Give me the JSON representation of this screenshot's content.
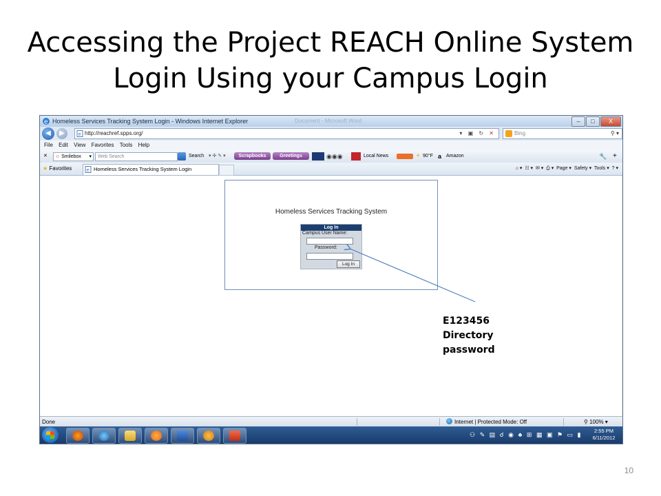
{
  "slide": {
    "title_line1": "Accessing the Project REACH Online System",
    "title_line2": "Login Using your Campus Login",
    "page_number": "10"
  },
  "browser": {
    "window_title": "Homeless Services Tracking System Login - Windows Internet Explorer",
    "ghost_tab": "Document - Microsoft Word",
    "window_controls": {
      "minimize": "–",
      "maximize": "□",
      "close": "X"
    },
    "address": "http://reachref.spps.org/",
    "search_provider": "Bing",
    "menu": [
      "File",
      "Edit",
      "View",
      "Favorites",
      "Tools",
      "Help"
    ],
    "toolbar": {
      "smilebox": "Smilebox",
      "search_placeholder": "Web Search",
      "search_label": "Search",
      "scrapbooks": "Scrapbooks",
      "greetings": "Greetings",
      "local_news": "Local News",
      "weather": "90°F",
      "amazon": "Amazon"
    },
    "favorites_label": "Favorites",
    "tab_title": "Homeless Services Tracking System Login",
    "command_bar": {
      "page": "Page",
      "safety": "Safety",
      "tools": "Tools"
    },
    "status": {
      "left": "Done",
      "zone": "Internet | Protected Mode: Off",
      "zoom": "100%"
    }
  },
  "login_page": {
    "system_title": "Homeless Services Tracking System",
    "panel_header": "Log In",
    "username_label": "Campus User Name:",
    "password_label": "Password:",
    "button_label": "Log In"
  },
  "callout": {
    "line1": "E123456",
    "line2": "Directory",
    "line3": "password",
    "color": "#4f81bd"
  },
  "taskbar": {
    "clock_time": "2:55 PM",
    "clock_date": "6/11/2012"
  }
}
